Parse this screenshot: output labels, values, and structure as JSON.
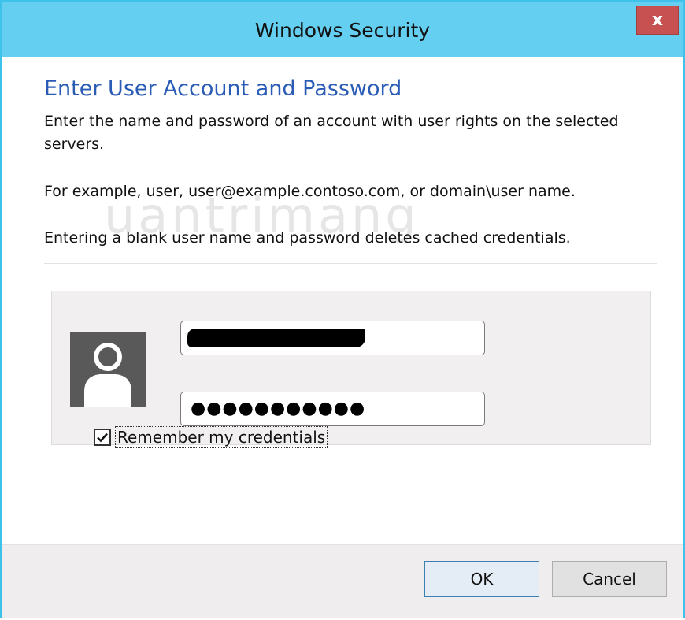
{
  "window": {
    "title": "Windows Security",
    "close_label": "x"
  },
  "content": {
    "heading": "Enter User Account and Password",
    "instructions": "Enter the name and password of an account with user rights on the selected servers.",
    "example": "For example, user, user@example.contoso.com, or domain\\user name.",
    "blank_note": "Entering a blank user name and password deletes cached credentials.",
    "watermark": "uantrimang"
  },
  "credentials": {
    "username_value": "",
    "username_redacted": true,
    "password_masked": "●●●●●●●●●●●",
    "user_icon": "user-silhouette-icon"
  },
  "remember": {
    "label": "Remember my credentials",
    "checked": true
  },
  "footer": {
    "ok_label": "OK",
    "cancel_label": "Cancel"
  },
  "colors": {
    "titlebar": "#64cff1",
    "border": "#3ec2e9",
    "heading": "#2a5bb5",
    "close": "#c75050",
    "ok_border": "#3c7fb1"
  }
}
